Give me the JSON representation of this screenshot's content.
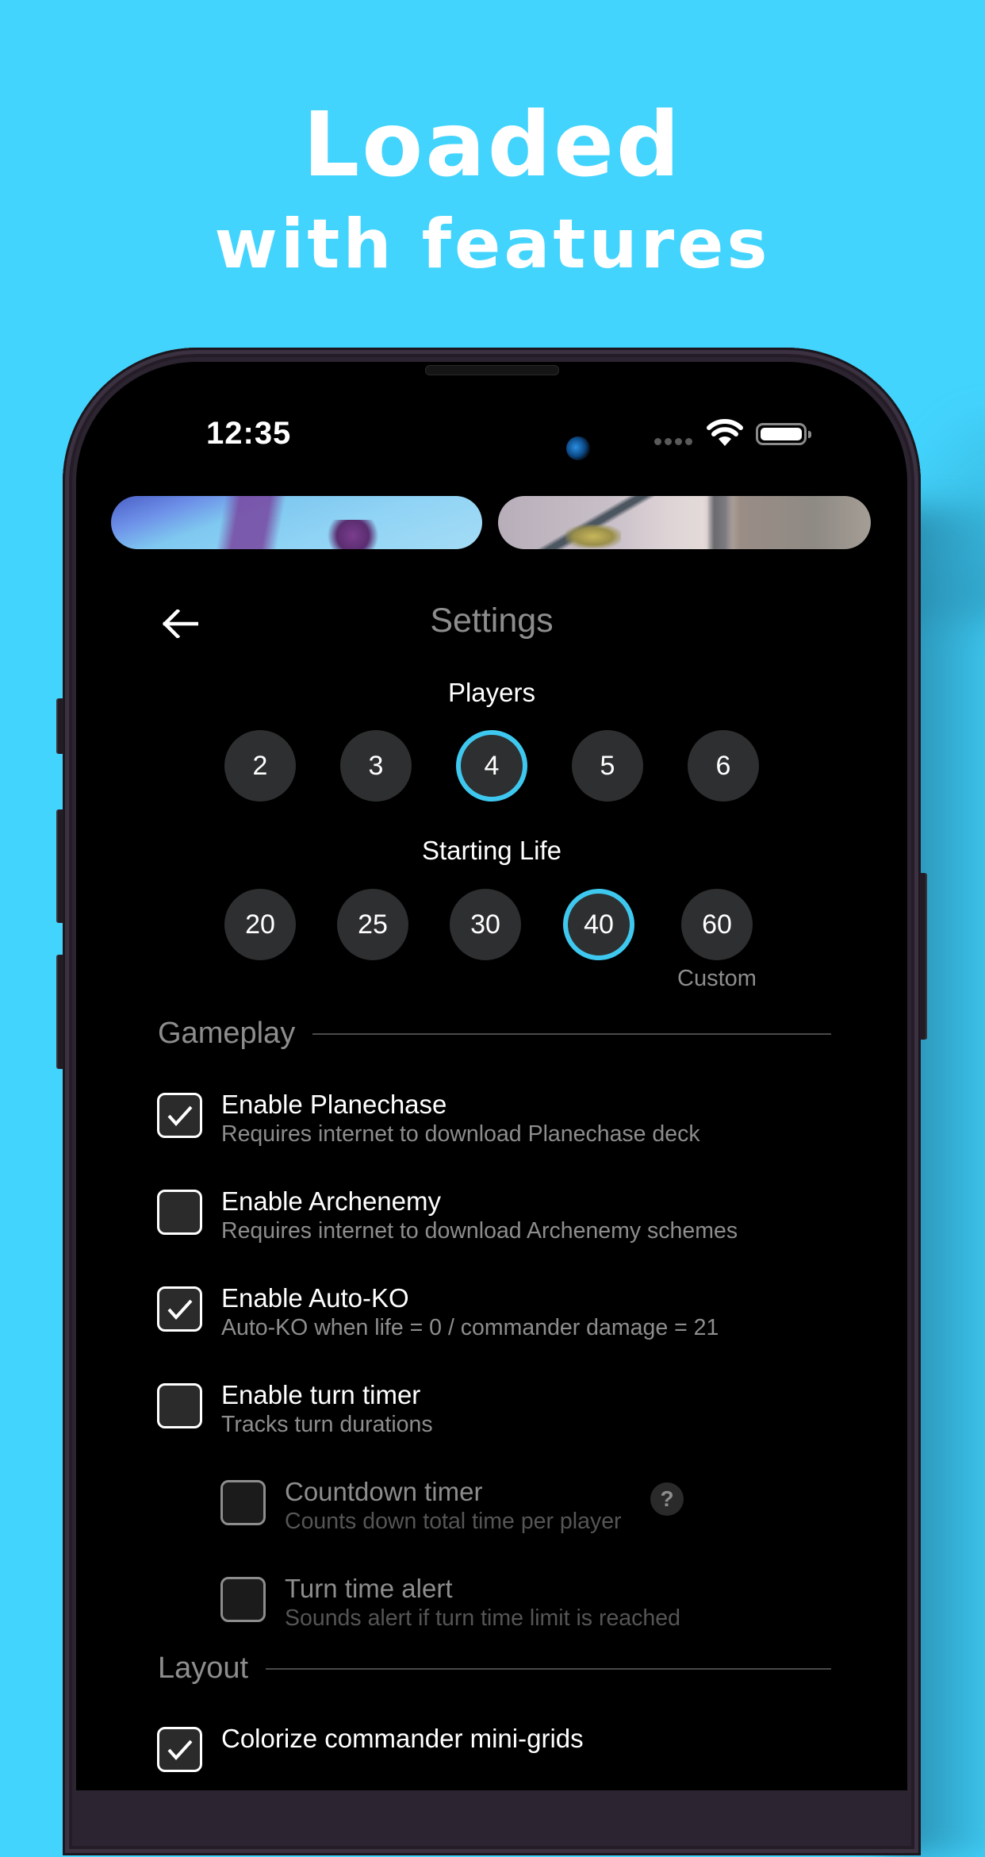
{
  "headline": {
    "line1": "Loaded",
    "line2": "with features"
  },
  "colors": {
    "background": "#43d4fd",
    "accent": "#3fc8ef",
    "screen": "#000000",
    "circle": "#2e2f30",
    "muted_text": "#8d8d8d"
  },
  "status_bar": {
    "time": "12:35",
    "icons": [
      "signal-dots-icon",
      "wifi-icon",
      "battery-icon"
    ]
  },
  "banners": [
    {
      "name": "card-art-banner-left"
    },
    {
      "name": "card-art-banner-right"
    }
  ],
  "header": {
    "back_icon": "arrow-left-icon",
    "title": "Settings"
  },
  "players": {
    "label": "Players",
    "options": [
      "2",
      "3",
      "4",
      "5",
      "6"
    ],
    "selected": "4"
  },
  "starting_life": {
    "label": "Starting Life",
    "options": [
      "20",
      "25",
      "30",
      "40",
      "60"
    ],
    "selected": "40",
    "custom_label": "Custom"
  },
  "sections": {
    "gameplay": {
      "label": "Gameplay",
      "items": [
        {
          "title": "Enable Planechase",
          "subtitle": "Requires internet to download Planechase deck",
          "checked": true,
          "enabled": true
        },
        {
          "title": "Enable Archenemy",
          "subtitle": "Requires internet to download Archenemy schemes",
          "checked": false,
          "enabled": true
        },
        {
          "title": "Enable Auto-KO",
          "subtitle": "Auto-KO when life = 0 / commander damage = 21",
          "checked": true,
          "enabled": true
        },
        {
          "title": "Enable turn timer",
          "subtitle": "Tracks turn durations",
          "checked": false,
          "enabled": true
        },
        {
          "title": "Countdown timer",
          "subtitle": "Counts down total time per player",
          "checked": false,
          "enabled": false,
          "help": "?"
        },
        {
          "title": "Turn time alert",
          "subtitle": "Sounds alert if turn time limit is reached",
          "checked": false,
          "enabled": false
        }
      ]
    },
    "layout": {
      "label": "Layout",
      "items": [
        {
          "title": "Colorize commander mini-grids",
          "checked": true,
          "enabled": true
        }
      ]
    }
  }
}
